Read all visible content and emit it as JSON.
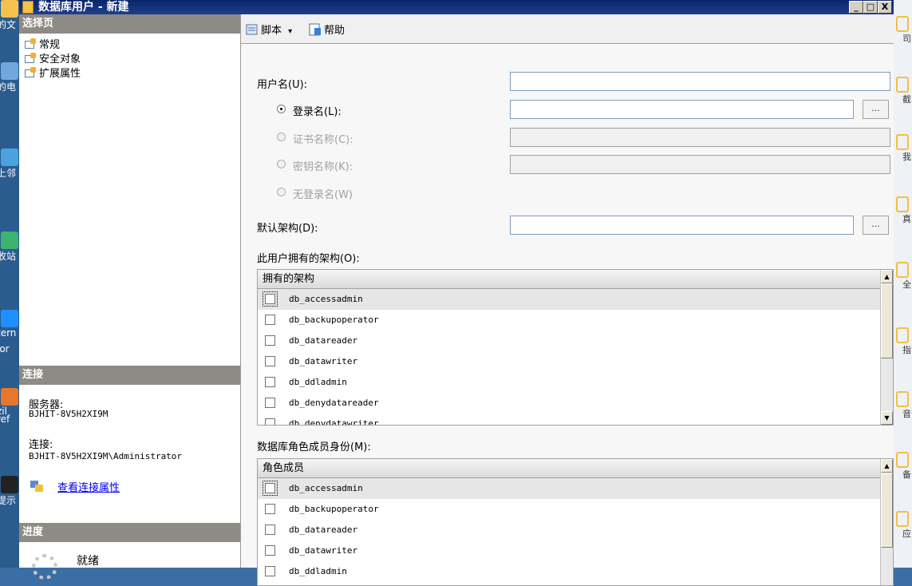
{
  "desktop_left": {
    "items": [
      {
        "label": "的文",
        "color": "#f2c14e"
      },
      {
        "label": "的电",
        "color": "#6fa8dc"
      },
      {
        "label": "上邻",
        "color": "#4aa3df"
      },
      {
        "label": "收站",
        "color": "#3cb371"
      },
      {
        "label": "tern",
        "color": "#1e90ff"
      },
      {
        "label": "lor",
        "color": ""
      },
      {
        "label": "zil",
        "color": "#e8762b"
      },
      {
        "label": "ref",
        "color": ""
      },
      {
        "label": "提示",
        "color": "#222222"
      }
    ]
  },
  "desktop_right": {
    "items": [
      "司",
      "截",
      "我",
      "真",
      "全",
      "指",
      "音",
      "备",
      "应"
    ]
  },
  "window": {
    "title": "数据库用户 - 新建",
    "minimize": "_",
    "maximize": "□",
    "close": "X"
  },
  "left_pane": {
    "select_page_header": "选择页",
    "pages": [
      {
        "label": "常规",
        "icon": "page-general-icon"
      },
      {
        "label": "安全对象",
        "icon": "page-securables-icon"
      },
      {
        "label": "扩展属性",
        "icon": "page-extended-properties-icon"
      }
    ],
    "connection_header": "连接",
    "server_label": "服务器:",
    "server_value": "BJHIT-8V5H2XI9M",
    "connection_label": "连接:",
    "connection_value": "BJHIT-8V5H2XI9M\\Administrator",
    "view_connection_link": "查看连接属性",
    "progress_header": "进度",
    "progress_status": "就绪"
  },
  "toolbar": {
    "script_label": "脚本",
    "script_dropdown": "▾",
    "help_label": "帮助"
  },
  "form": {
    "username_label": "用户名(U):",
    "username_value": "",
    "login_name_label": "登录名(L):",
    "login_name_value": "",
    "cert_name_label": "证书名称(C):",
    "key_name_label": "密钥名称(K):",
    "no_login_label": "无登录名(W)",
    "browse_label": "...",
    "default_schema_label": "默认架构(D):",
    "default_schema_value": "",
    "owned_schemas_label": "此用户拥有的架构(O):",
    "owned_schemas_header": "拥有的架构",
    "owned_schemas": [
      "db_accessadmin",
      "db_backupoperator",
      "db_datareader",
      "db_datawriter",
      "db_ddladmin",
      "db_denydatareader",
      "db_denydatawriter"
    ],
    "role_membership_label": "数据库角色成员身份(M):",
    "role_membership_header": "角色成员",
    "roles": [
      "db_accessadmin",
      "db_backupoperator",
      "db_datareader",
      "db_datawriter",
      "db_ddladmin"
    ]
  }
}
